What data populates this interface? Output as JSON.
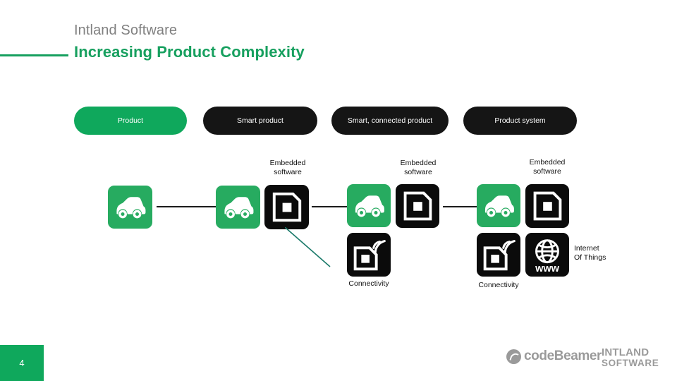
{
  "slide": {
    "page_number": "4",
    "eyebrow": "Intland Software",
    "headline": "Increasing Product Complexity",
    "accent_green": "#17a05f",
    "tile_green": "#27ab60",
    "tile_black": "#0b0b0b",
    "diagonal_line_color": "#1b7a6a"
  },
  "stages": [
    {
      "label": "Product",
      "style": "green"
    },
    {
      "label": "Smart product",
      "style": "black"
    },
    {
      "label": "Smart, connected\nproduct",
      "style": "black"
    },
    {
      "label": "Product system",
      "style": "black"
    }
  ],
  "captions": {
    "embedded_software_1": "Embedded\nsoftware",
    "embedded_software_2": "Embedded\nsoftware",
    "embedded_software_3": "Embedded\nsoftware",
    "connectivity_1": "Connectivity",
    "connectivity_2": "Connectivity",
    "internet_of_things": "Internet\nOf Things"
  },
  "icons": {
    "car": "car-icon",
    "embedded_software": "chip-icon",
    "connectivity": "chip-wifi-icon",
    "internet": "globe-www-icon",
    "www_label": "www"
  },
  "footer": {
    "codebeamer": "codeBeamer",
    "intland_line1": "INTLAND",
    "intland_line2": "SOFTWARE"
  }
}
